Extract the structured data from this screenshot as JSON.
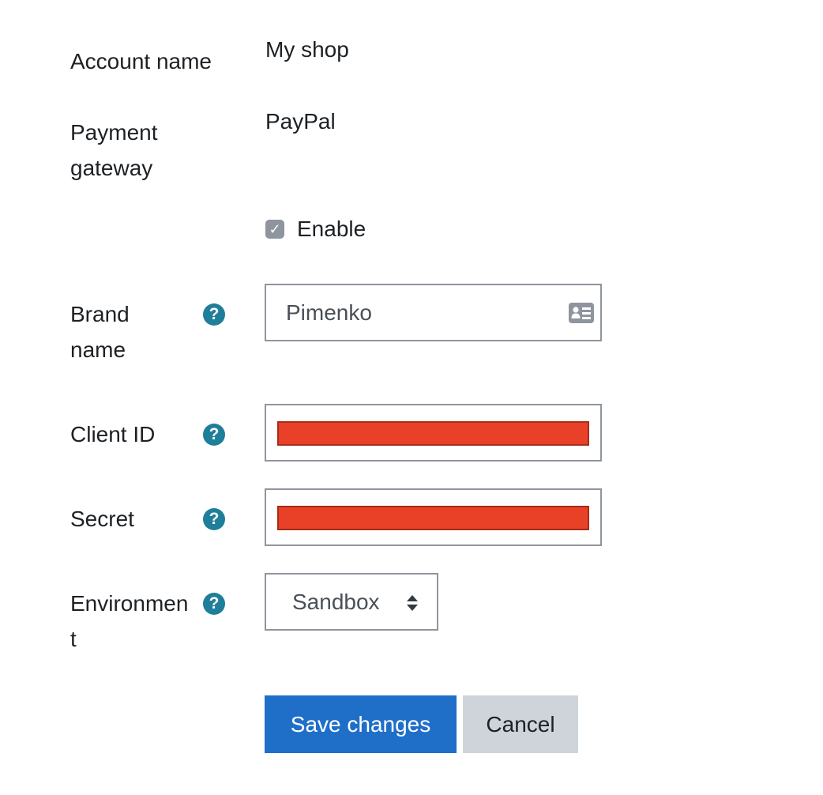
{
  "form": {
    "account_name": {
      "label": "Account name",
      "value": "My shop"
    },
    "payment_gateway": {
      "label_line1": "Payment",
      "label_line2": "gateway",
      "value": "PayPal"
    },
    "enable": {
      "label": "Enable",
      "checked": true,
      "check_glyph": "✓"
    },
    "brand_name": {
      "label_line1": "Brand",
      "label_line2": "name",
      "value": "Pimenko",
      "icon": "contact-card-icon"
    },
    "client_id": {
      "label": "Client ID",
      "value_redacted": true
    },
    "secret": {
      "label": "Secret",
      "value_redacted": true
    },
    "environment": {
      "label_line1": "Environmen",
      "label_line2": "t",
      "selected": "Sandbox"
    },
    "help_glyph": "?"
  },
  "buttons": {
    "save_label": "Save changes",
    "cancel_label": "Cancel"
  },
  "colors": {
    "primary": "#1f6fc9",
    "secondary": "#ced4da",
    "help_icon": "#1f7e9a",
    "redaction": "#e84127",
    "checkbox": "#8f959e"
  }
}
